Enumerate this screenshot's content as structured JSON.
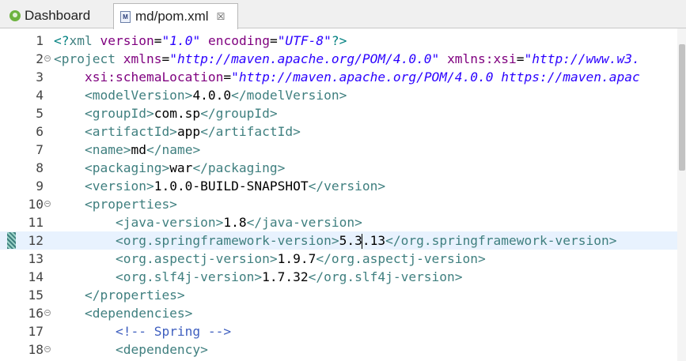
{
  "tabs": [
    {
      "label": "Dashboard",
      "icon": "spring-icon"
    },
    {
      "label": "md/pom.xml",
      "icon": "maven-pom-icon",
      "close": "☒"
    }
  ],
  "editor": {
    "lines": [
      {
        "n": "1",
        "fold": "",
        "code": "<span class=\"p\">&lt;?</span><span class=\"t\">xml</span> <span class=\"a\">version</span>=<span class=\"v\">\"1.0\"</span> <span class=\"a\">encoding</span>=<span class=\"v\">\"UTF-8\"</span><span class=\"p\">?&gt;</span>"
      },
      {
        "n": "2",
        "fold": "−",
        "code": "<span class=\"t\">&lt;project</span> <span class=\"a\">xmlns</span>=<span class=\"v\">\"http://maven.apache.org/POM/4.0.0\"</span> <span class=\"a\">xmlns:xsi</span>=<span class=\"v\">\"http://www.w3.</span>"
      },
      {
        "n": "3",
        "fold": "",
        "code": "    <span class=\"a\">xsi:schemaLocation</span>=<span class=\"v\">\"http://maven.apache.org/POM/4.0.0 https://maven.apac</span>"
      },
      {
        "n": "4",
        "fold": "",
        "code": "    <span class=\"t\">&lt;modelVersion&gt;</span>4.0.0<span class=\"t\">&lt;/modelVersion&gt;</span>"
      },
      {
        "n": "5",
        "fold": "",
        "code": "    <span class=\"t\">&lt;groupId&gt;</span>com.sp<span class=\"t\">&lt;/groupId&gt;</span>"
      },
      {
        "n": "6",
        "fold": "",
        "code": "    <span class=\"t\">&lt;artifactId&gt;</span>app<span class=\"t\">&lt;/artifactId&gt;</span>"
      },
      {
        "n": "7",
        "fold": "",
        "code": "    <span class=\"t\">&lt;name&gt;</span>md<span class=\"t\">&lt;/name&gt;</span>"
      },
      {
        "n": "8",
        "fold": "",
        "code": "    <span class=\"t\">&lt;packaging&gt;</span>war<span class=\"t\">&lt;/packaging&gt;</span>"
      },
      {
        "n": "9",
        "fold": "",
        "code": "    <span class=\"t\">&lt;version&gt;</span>1.0.0-BUILD-SNAPSHOT<span class=\"t\">&lt;/version&gt;</span>"
      },
      {
        "n": "10",
        "fold": "−",
        "code": "    <span class=\"t\">&lt;properties&gt;</span>"
      },
      {
        "n": "11",
        "fold": "",
        "code": "        <span class=\"t\">&lt;java-version&gt;</span>1.8<span class=\"t\">&lt;/java-version&gt;</span>"
      },
      {
        "n": "12",
        "fold": "",
        "current": true,
        "code": "        <span class=\"t\">&lt;org.springframework-version&gt;</span>5.3<span class=\"cursor\"></span>.13<span class=\"t\">&lt;/org.springframework-version&gt;</span>"
      },
      {
        "n": "13",
        "fold": "",
        "code": "        <span class=\"t\">&lt;org.aspectj-version&gt;</span>1.9.7<span class=\"t\">&lt;/org.aspectj-version&gt;</span>"
      },
      {
        "n": "14",
        "fold": "",
        "code": "        <span class=\"t\">&lt;org.slf4j-version&gt;</span>1.7.32<span class=\"t\">&lt;/org.slf4j-version&gt;</span>"
      },
      {
        "n": "15",
        "fold": "",
        "code": "    <span class=\"t\">&lt;/properties&gt;</span>"
      },
      {
        "n": "16",
        "fold": "−",
        "code": "    <span class=\"t\">&lt;dependencies&gt;</span>"
      },
      {
        "n": "17",
        "fold": "",
        "code": "        <span class=\"c\">&lt;!-- Spring --&gt;</span>"
      },
      {
        "n": "18",
        "fold": "−",
        "code": "        <span class=\"t\">&lt;dependency&gt;</span>"
      }
    ]
  }
}
